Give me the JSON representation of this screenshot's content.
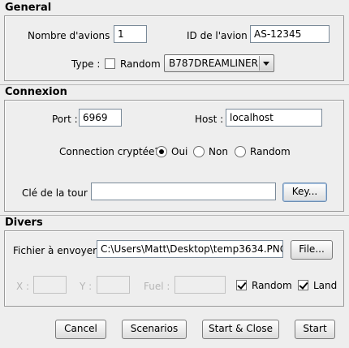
{
  "general": {
    "title": "General",
    "nb_avions_label": "Nombre d'avions :",
    "nb_avions_value": "1",
    "id_avion_label": "ID de l'avion :",
    "id_avion_value": "AS-12345",
    "type_label": "Type :",
    "random_label": "Random",
    "random_checked": false,
    "type_selected": "B787DREAMLINER"
  },
  "connexion": {
    "title": "Connexion",
    "port_label": "Port :",
    "port_value": "6969",
    "host_label": "Host :",
    "host_value": "localhost",
    "crypt_label": "Connection cryptée?",
    "crypt_options": [
      "Oui",
      "Non",
      "Random"
    ],
    "crypt_selected": "Oui",
    "key_label": "Clé de la tour :",
    "key_value": "",
    "key_button": "Key..."
  },
  "divers": {
    "title": "Divers",
    "file_label": "Fichier à envoyer :",
    "file_value": "C:\\Users\\Matt\\Desktop\\temp3634.PNG",
    "file_button": "File...",
    "x_label": "X :",
    "y_label": "Y :",
    "fuel_label": "Fuel :",
    "random_label": "Random",
    "random_checked": true,
    "land_label": "Land",
    "land_checked": true
  },
  "buttons": {
    "cancel": "Cancel",
    "scenarios": "Scenarios",
    "start_close": "Start & Close",
    "start": "Start"
  }
}
